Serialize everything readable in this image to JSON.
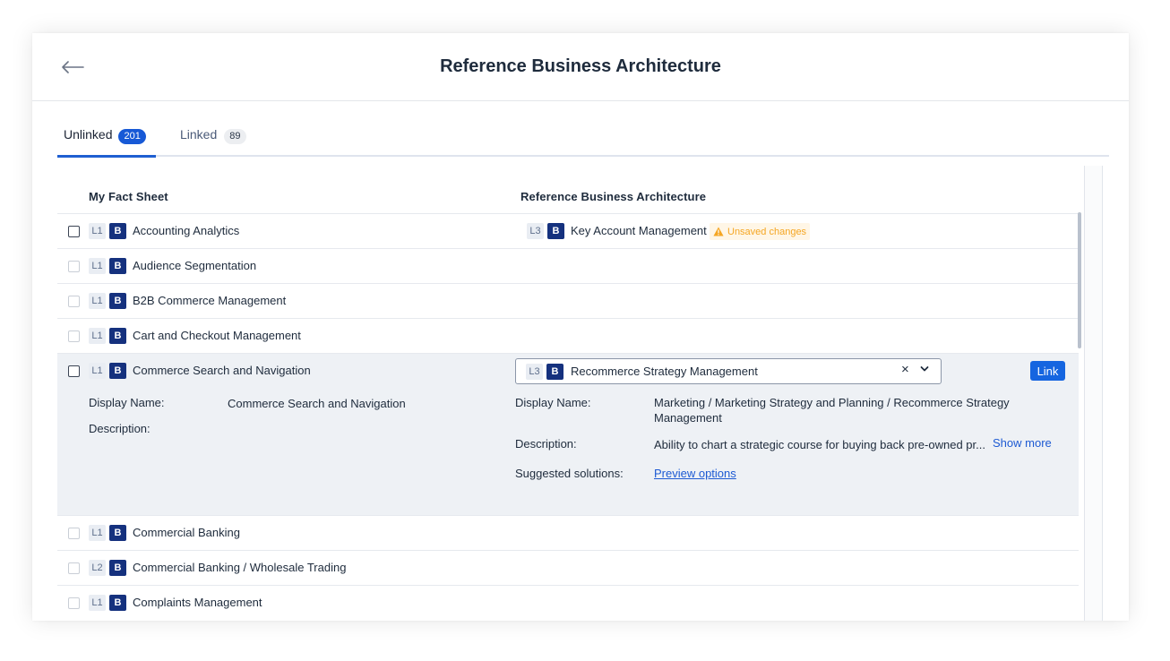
{
  "header": {
    "title": "Reference Business Architecture",
    "back_icon": "arrow-left-icon"
  },
  "tabs": [
    {
      "label": "Unlinked",
      "count": "201",
      "active": true
    },
    {
      "label": "Linked",
      "count": "89",
      "active": false
    }
  ],
  "columns": {
    "left": "My Fact Sheet",
    "right": "Reference Business Architecture"
  },
  "type_badge": "B",
  "rows": [
    {
      "level": "L1",
      "name": "Accounting Analytics",
      "ref_level": "L3",
      "ref_name": "Key Account Management",
      "warning": "Unsaved changes"
    },
    {
      "level": "L1",
      "name": "Audience Segmentation"
    },
    {
      "level": "L1",
      "name": "B2B Commerce Management"
    },
    {
      "level": "L1",
      "name": "Cart and Checkout Management"
    },
    {
      "level": "L1",
      "name": "Commerce Search and Navigation"
    },
    {
      "level": "L1",
      "name": "Commercial Banking"
    },
    {
      "level": "L2",
      "name": "Commercial Banking / Wholesale Trading"
    },
    {
      "level": "L1",
      "name": "Complaints Management"
    }
  ],
  "expanded": {
    "combo_level": "L3",
    "combo_value": "Recommerce Strategy Management",
    "clear_glyph": "×",
    "link_label": "Link",
    "left": {
      "display_name_label": "Display Name:",
      "display_name_value": "Commerce Search and Navigation",
      "description_label": "Description:"
    },
    "right": {
      "display_name_label": "Display Name:",
      "display_name_value": "Marketing / Marketing Strategy and Planning / Recommerce Strategy Management",
      "description_label": "Description:",
      "description_value": "Ability to chart a strategic course for buying back pre-owned pr...",
      "show_more": "Show more",
      "suggested_label": "Suggested solutions:",
      "suggested_link": "Preview options"
    }
  },
  "colors": {
    "accent": "#1565e0",
    "type_badge_bg": "#15317e",
    "warning": "#f5a623",
    "expanded_bg": "#eef1f5"
  }
}
